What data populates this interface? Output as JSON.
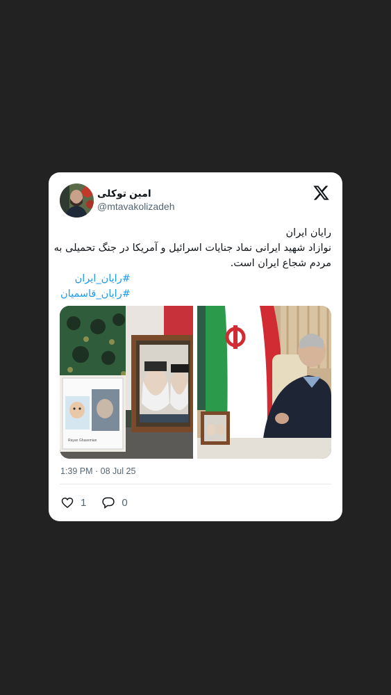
{
  "author": {
    "display_name": "امین توکلی",
    "handle": "@mtavakolizadeh"
  },
  "tweet": {
    "lines": [
      "رایان ایران",
      "نوازاد شهید ایرانی نماد جنایات اسرائیل و آمریکا در جنگ تحمیلی به",
      "مردم شجاع ایران است."
    ],
    "hashtags": [
      "#رایان_ایران",
      "#رایان_قاسمیان"
    ],
    "timestamp": "1:39 PM · 08 Jul 25"
  },
  "metrics": {
    "likes": "1",
    "replies": "0"
  },
  "media": {
    "left_frame_caption": "Rayan Ghasemian"
  },
  "colors": {
    "background": "#222222",
    "card": "#ffffff",
    "hashtag": "#1d9bf0",
    "muted": "#536471"
  },
  "icons": [
    "x-logo-icon",
    "heart-icon",
    "reply-bubble-icon"
  ]
}
